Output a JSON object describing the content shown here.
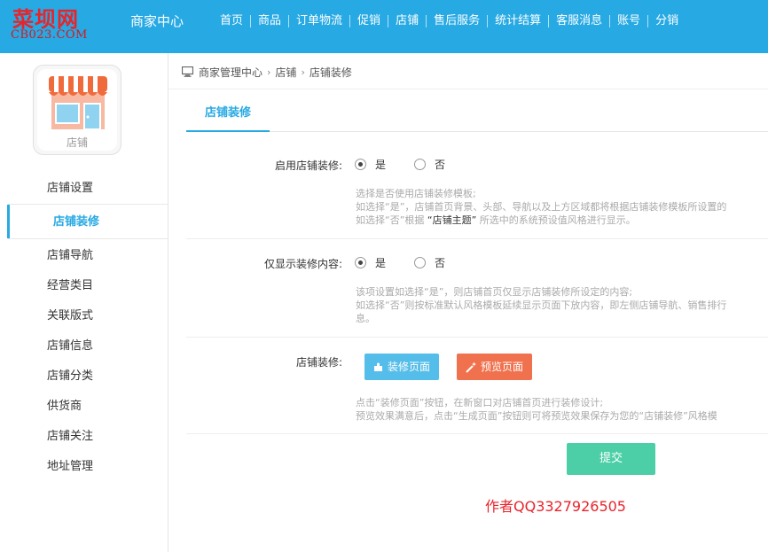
{
  "logo": {
    "main": "菜坝网",
    "sub": "CB023.COM"
  },
  "header": {
    "brand": "商家中心",
    "nav": [
      "首页",
      "商品",
      "订单物流",
      "促销",
      "店铺",
      "售后服务",
      "统计结算",
      "客服消息",
      "账号",
      "分销"
    ]
  },
  "sidebar": {
    "card_label": "店铺",
    "items": [
      {
        "label": "店铺设置"
      },
      {
        "label": "店铺装修",
        "active": true
      },
      {
        "label": "店铺导航"
      },
      {
        "label": "经营类目"
      },
      {
        "label": "关联版式"
      },
      {
        "label": "店铺信息"
      },
      {
        "label": "店铺分类"
      },
      {
        "label": "供货商"
      },
      {
        "label": "店铺关注"
      },
      {
        "label": "地址管理"
      }
    ]
  },
  "breadcrumb": [
    "商家管理中心",
    "店铺",
    "店铺装修"
  ],
  "tab": "店铺装修",
  "form": {
    "enable": {
      "label": "启用店铺装修:",
      "yes": "是",
      "no": "否",
      "hint1": "选择是否使用店铺装修模板;",
      "hint2": "如选择“是”，店铺首页背景、头部、导航以及上方区域都将根据店铺装修模板所设置的",
      "hint3a": "如选择“否”根据 ",
      "hint3b": "“店铺主题”",
      "hint3c": " 所选中的系统预设值风格进行显示。"
    },
    "only": {
      "label": "仅显示装修内容:",
      "yes": "是",
      "no": "否",
      "hint1": "该项设置如选择“是”，则店铺首页仅显示店铺装修所设定的内容;",
      "hint2": "如选择“否”则按标准默认风格模板延续显示页面下放内容，即左侧店铺导航、销售排行",
      "hint3": "息。"
    },
    "decorate": {
      "label": "店铺装修:",
      "edit_button": "装修页面",
      "preview_button": "预览页面",
      "hint1": "点击“装修页面”按钮，在新窗口对店铺首页进行装修设计;",
      "hint2": "预览效果满意后，点击“生成页面”按钮则可将预览效果保存为您的“店铺装修”风格模"
    },
    "submit": "提交"
  },
  "watermark": "作者QQ3327926505"
}
